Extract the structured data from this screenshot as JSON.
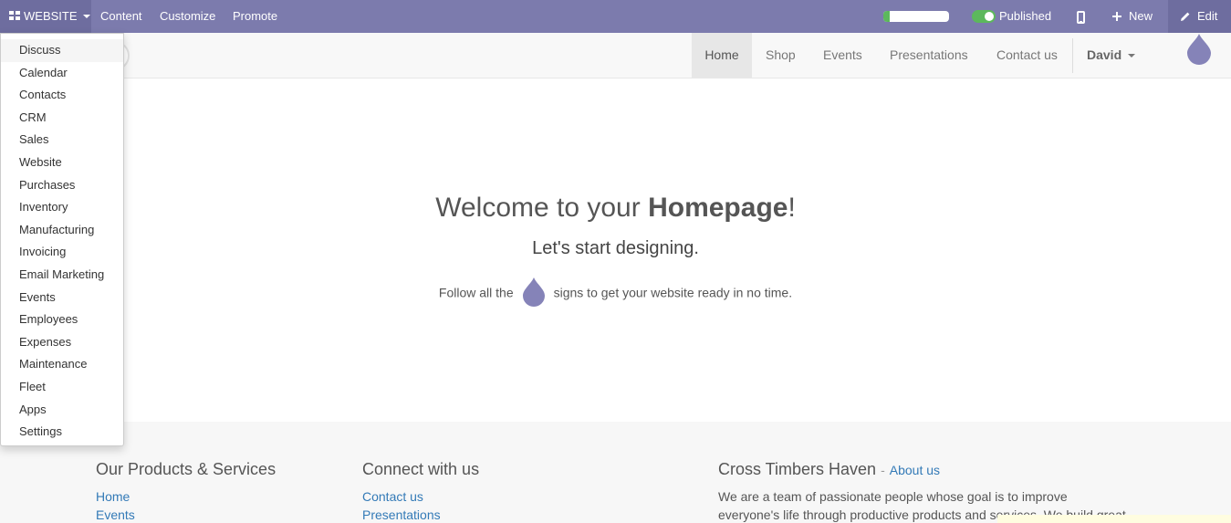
{
  "topbar": {
    "apps_label": "WEBSITE",
    "menus": [
      "Content",
      "Customize",
      "Promote"
    ],
    "progress": 0.1,
    "published_label": "Published",
    "published_on": true,
    "new_label": "New",
    "edit_label": "Edit",
    "bg_color": "#7c7bad"
  },
  "navbar": {
    "items": [
      "Home",
      "Shop",
      "Events",
      "Presentations",
      "Contact us"
    ],
    "active": "Home",
    "user": "David"
  },
  "hero": {
    "title_prefix": "Welcome to your ",
    "title_bold": "Homepage",
    "title_suffix": "!",
    "subtitle": "Let's start designing.",
    "follow_before": "Follow all the",
    "follow_after": "signs to get your website ready in no time."
  },
  "footer": {
    "col1": {
      "heading": "Our Products & Services",
      "links": [
        "Home",
        "Events"
      ]
    },
    "col2": {
      "heading": "Connect with us",
      "links": [
        "Contact us",
        "Presentations"
      ]
    },
    "col3": {
      "heading": "Cross Timbers Haven",
      "separator": "-",
      "about_link": "About us",
      "text_lines": [
        "We are a team of passionate people whose goal is to improve",
        "everyone's life through productive products and services. We build great"
      ]
    }
  },
  "apps_menu": {
    "items": [
      "Discuss",
      "Calendar",
      "Contacts",
      "CRM",
      "Sales",
      "Website",
      "Purchases",
      "Inventory",
      "Manufacturing",
      "Invoicing",
      "Email Marketing",
      "Events",
      "Employees",
      "Expenses",
      "Maintenance",
      "Fleet",
      "Apps",
      "Settings"
    ],
    "hovered": "Discuss"
  },
  "icons": {
    "apps": "apps-grid-icon",
    "mobile": "mobile-phone-icon",
    "new": "plus-icon",
    "edit": "pencil-icon",
    "hint": "droplet-icon"
  },
  "colors": {
    "accent": "#7c7bad",
    "droplet": "#8583b8",
    "link": "#337ab7",
    "published": "#5cb85c"
  }
}
